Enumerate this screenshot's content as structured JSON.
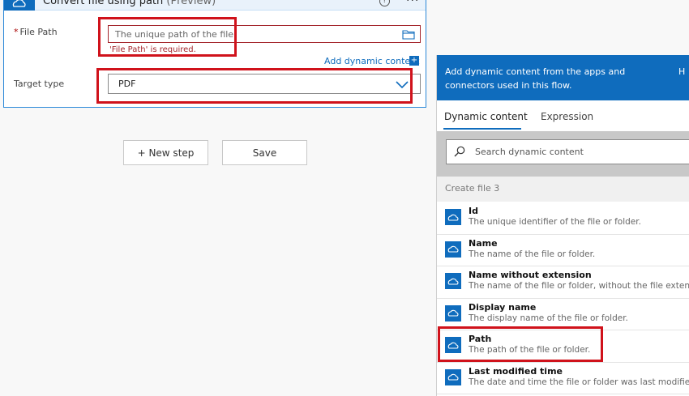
{
  "card": {
    "title": "Convert file using path",
    "title_suffix": "(Preview)",
    "help_glyph": "?",
    "more_glyph": "···",
    "file_path": {
      "required_mark": "*",
      "label": "File Path",
      "placeholder": "The unique path of the file.",
      "error": "'File Path' is required."
    },
    "add_dynamic_content": "Add dynamic content",
    "add_dynamic_glyph": "+",
    "target_type": {
      "label": "Target type",
      "value": "PDF"
    }
  },
  "buttons": {
    "new_step": "+ New step",
    "save": "Save"
  },
  "panel": {
    "header_text": "Add dynamic content from the apps and connectors used in this flow.",
    "hide_label": "H",
    "tabs": [
      {
        "label": "Dynamic content",
        "active": true
      },
      {
        "label": "Expression",
        "active": false
      }
    ],
    "search_placeholder": "Search dynamic content",
    "group_title": "Create file 3",
    "items": [
      {
        "title": "Id",
        "description": "The unique identifier of the file or folder."
      },
      {
        "title": "Name",
        "description": "The name of the file or folder."
      },
      {
        "title": "Name without extension",
        "description": "The name of the file or folder, without the file extension."
      },
      {
        "title": "Display name",
        "description": "The display name of the file or folder."
      },
      {
        "title": "Path",
        "description": "The path of the file or folder."
      },
      {
        "title": "Last modified time",
        "description": "The date and time the file or folder was last modified."
      }
    ],
    "item_icon": "onedrive-cloud-icon"
  },
  "colors": {
    "accent": "#0f6cbd",
    "error": "#a4262c",
    "highlight": "#d0121b"
  }
}
